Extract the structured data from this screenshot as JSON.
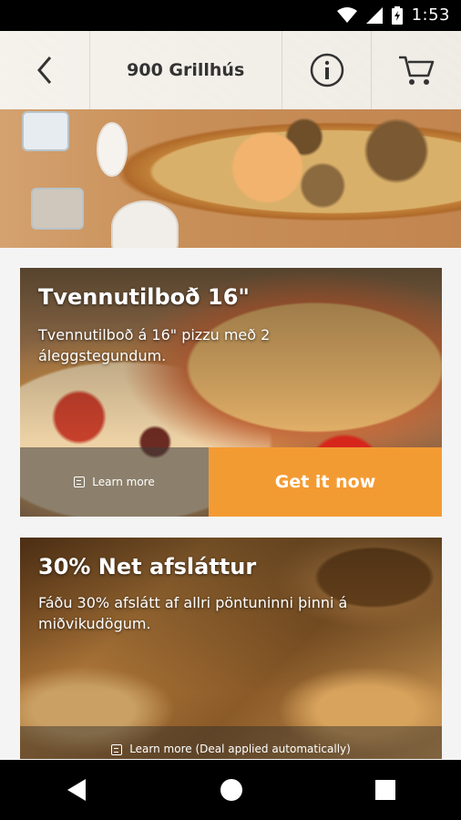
{
  "status_bar": {
    "time": "1:53",
    "icons": [
      "wifi-icon",
      "signal-icon",
      "battery-icon"
    ]
  },
  "header": {
    "title": "900 Grillhús",
    "icons": [
      "back-arrow-icon",
      "info-icon",
      "cart-icon"
    ]
  },
  "deals": [
    {
      "title": "Tvennutilboð 16\"",
      "description": "Tvennutilboð á 16\" pizzu með 2 áleggstegundum.",
      "learn_more": "Learn more",
      "cta": "Get it now"
    },
    {
      "title": "30% Net afsláttur",
      "description": "Fáðu 30% afslátt af allri pöntuninni þinni á miðvikudögum.",
      "learn_more": "Learn more (Deal applied automatically)"
    }
  ],
  "colors": {
    "cta_orange": "#f39b33",
    "status_bar": "#000000",
    "nav_bar": "#000000"
  },
  "nav_bar": {
    "icons": [
      "nav-back-icon",
      "nav-home-icon",
      "nav-recents-icon"
    ]
  }
}
